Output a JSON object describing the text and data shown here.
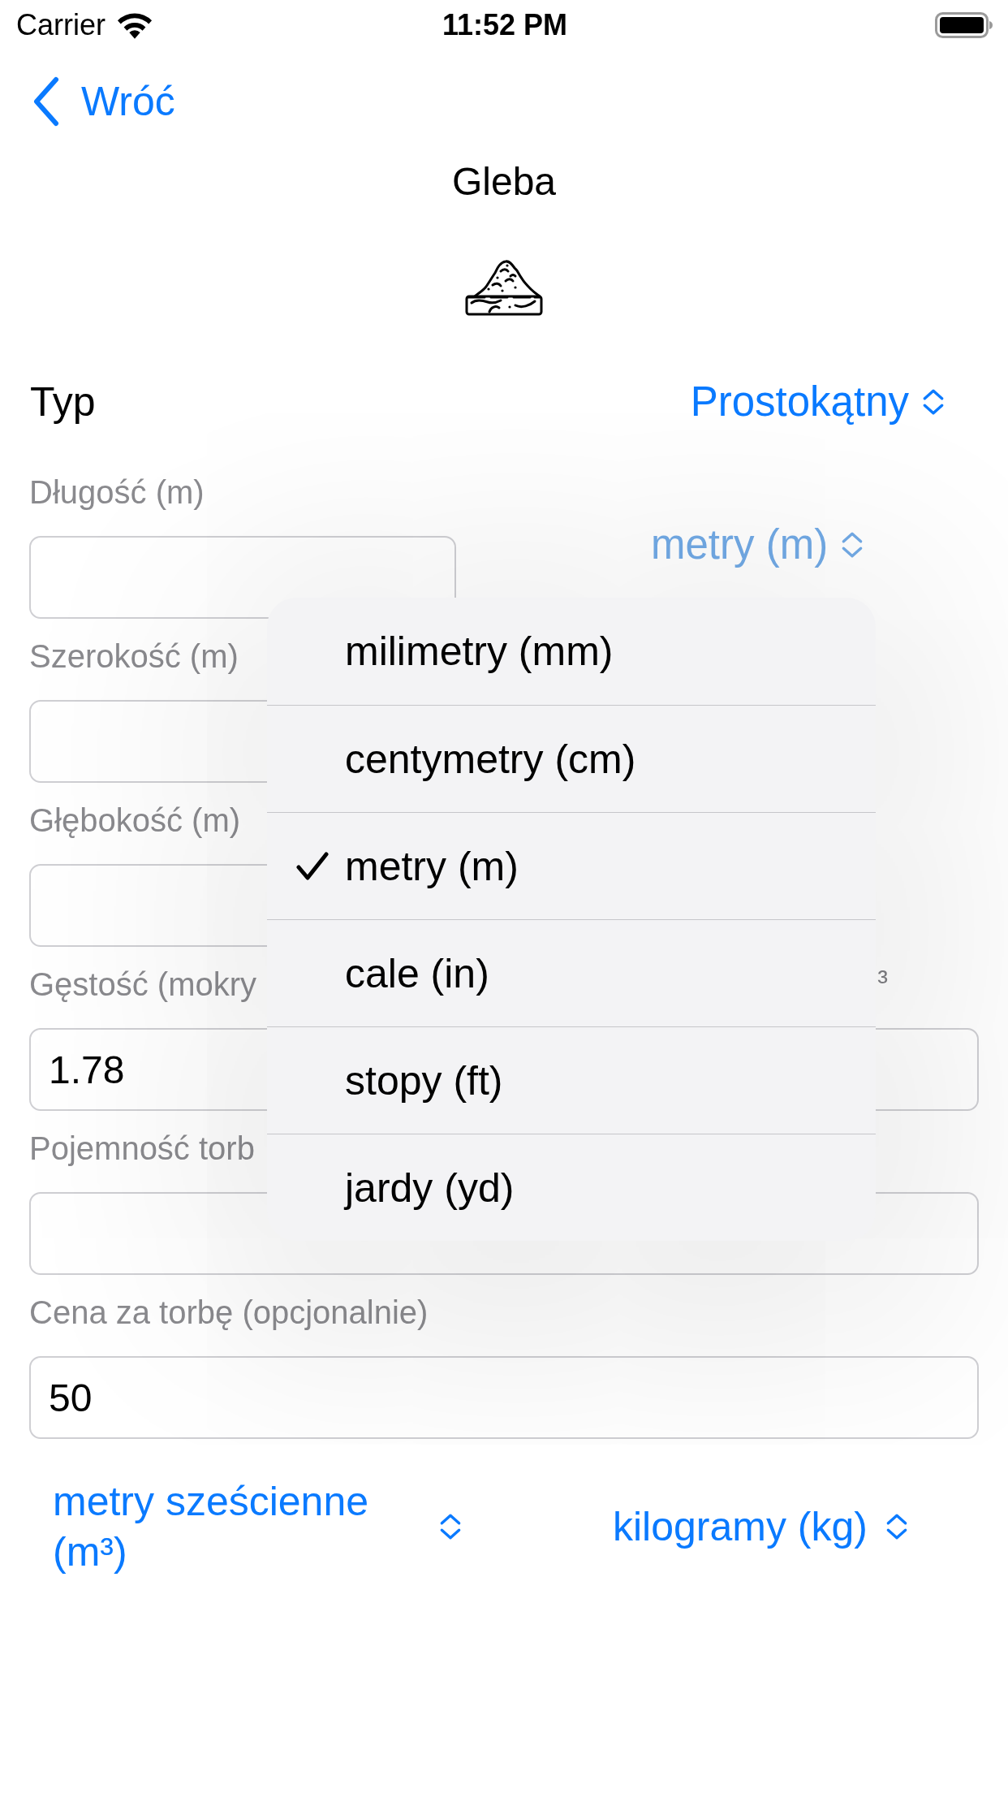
{
  "status_bar": {
    "carrier": "Carrier",
    "time": "11:52 PM"
  },
  "nav": {
    "back_label": "Wróć",
    "title": "Gleba"
  },
  "type_row": {
    "label": "Typ",
    "value": "Prostokątny"
  },
  "dimensions": {
    "fields": [
      {
        "label": "Długość (m)"
      },
      {
        "label": "Szerokość (m)"
      },
      {
        "label": "Głębokość (m)"
      }
    ],
    "unit_picker": {
      "value": "metry (m)",
      "open": true,
      "options": [
        {
          "label": "milimetry (mm)",
          "selected": false
        },
        {
          "label": "centymetry (cm)",
          "selected": false
        },
        {
          "label": "metry (m)",
          "selected": true
        },
        {
          "label": "cale (in)",
          "selected": false
        },
        {
          "label": "stopy (ft)",
          "selected": false
        },
        {
          "label": "jardy (yd)",
          "selected": false
        }
      ]
    }
  },
  "fields": [
    {
      "label": "Gęstość (mokry",
      "side_text": "³",
      "value": "1.78"
    },
    {
      "label": "Pojemność torb"
    },
    {
      "label": "Cena za torbę (opcjonalnie)",
      "value": "50"
    }
  ],
  "result_pickers": [
    {
      "value": "metry sześcienne (m³)"
    },
    {
      "value": "kilogramy (kg)"
    }
  ]
}
